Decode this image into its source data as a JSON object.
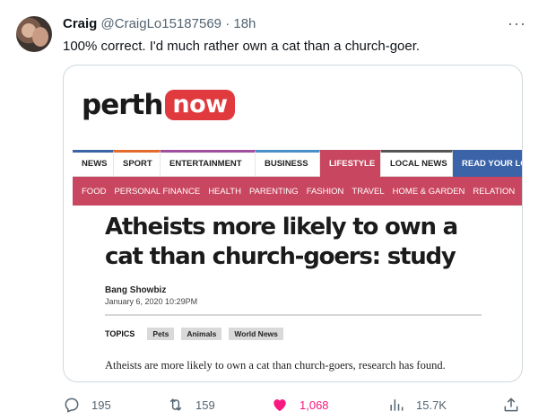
{
  "tweet": {
    "name": "Craig",
    "handle": "@CraigLo15187569",
    "separator": "·",
    "time": "18h",
    "more": "···",
    "text": "100% correct. I'd much rather own a cat than a church-goer."
  },
  "article": {
    "logo_left": "perth",
    "logo_right": "now",
    "nav": [
      "NEWS",
      "SPORT",
      "ENTERTAINMENT",
      "BUSINESS",
      "LIFESTYLE",
      "LOCAL NEWS",
      "READ YOUR LO"
    ],
    "subnav": [
      "FOOD",
      "PERSONAL FINANCE",
      "HEALTH",
      "PARENTING",
      "FASHION",
      "TRAVEL",
      "HOME & GARDEN",
      "RELATION"
    ],
    "headline": "Atheists more likely to own a cat than church-goers: study",
    "author": "Bang Showbiz",
    "date": "January 6, 2020 10:29PM",
    "topics_label": "TOPICS",
    "topics": [
      "Pets",
      "Animals",
      "World News"
    ],
    "lede": "Atheists are more likely to own a cat than church-goers, research has found."
  },
  "actions": {
    "replies": "195",
    "reposts": "159",
    "likes": "1,068",
    "views": "15.7K"
  },
  "colors": {
    "like_pink": "#f91880",
    "lifestyle_red": "#c8465f",
    "logo_red": "#e03a3e",
    "read_blue": "#3b63a8"
  },
  "icons": [
    "reply-icon",
    "repost-icon",
    "like-heart-icon",
    "views-chart-icon",
    "share-icon",
    "more-dots-icon"
  ]
}
